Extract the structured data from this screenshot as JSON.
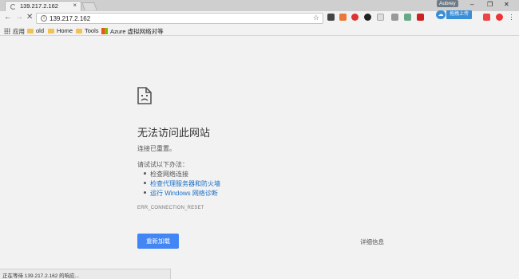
{
  "tab": {
    "title": "139.217.2.162",
    "close": "×"
  },
  "user": {
    "name": "Aubrey"
  },
  "window": {
    "minimize": "–",
    "restore": "❐",
    "close": "✕"
  },
  "nav": {
    "back": "←",
    "forward": "→",
    "stop": "✕"
  },
  "omnibox": {
    "url": "139.217.2.162",
    "star": "☆"
  },
  "upload": {
    "label": "拖拽上传"
  },
  "bookmarks": {
    "apps": "应用",
    "old": "old",
    "home": "Home",
    "tools": "Tools",
    "azure": "Azure 虚拟网络对等"
  },
  "error": {
    "title": "无法访问此网站",
    "subtitle": "连接已重置。",
    "try_heading": "请试试以下办法：",
    "suggestions": [
      "检查网络连接",
      "检查代理服务器和防火墙",
      "运行 Windows 网络诊断"
    ],
    "code": "ERR_CONNECTION_RESET",
    "reload": "重新加载",
    "details": "详细信息"
  },
  "status": {
    "text": "正在等待 139.217.2.162 的响应..."
  },
  "colors": {
    "accent": "#4285f4",
    "link": "#1a6fc4",
    "background": "#f2f2f2"
  },
  "icons": [
    "loading-spinner-icon",
    "info-icon",
    "star-icon",
    "apps-grid-icon",
    "folder-icon",
    "windows-logo-icon",
    "sad-document-icon",
    "cloud-icon",
    "menu-dots-icon"
  ]
}
